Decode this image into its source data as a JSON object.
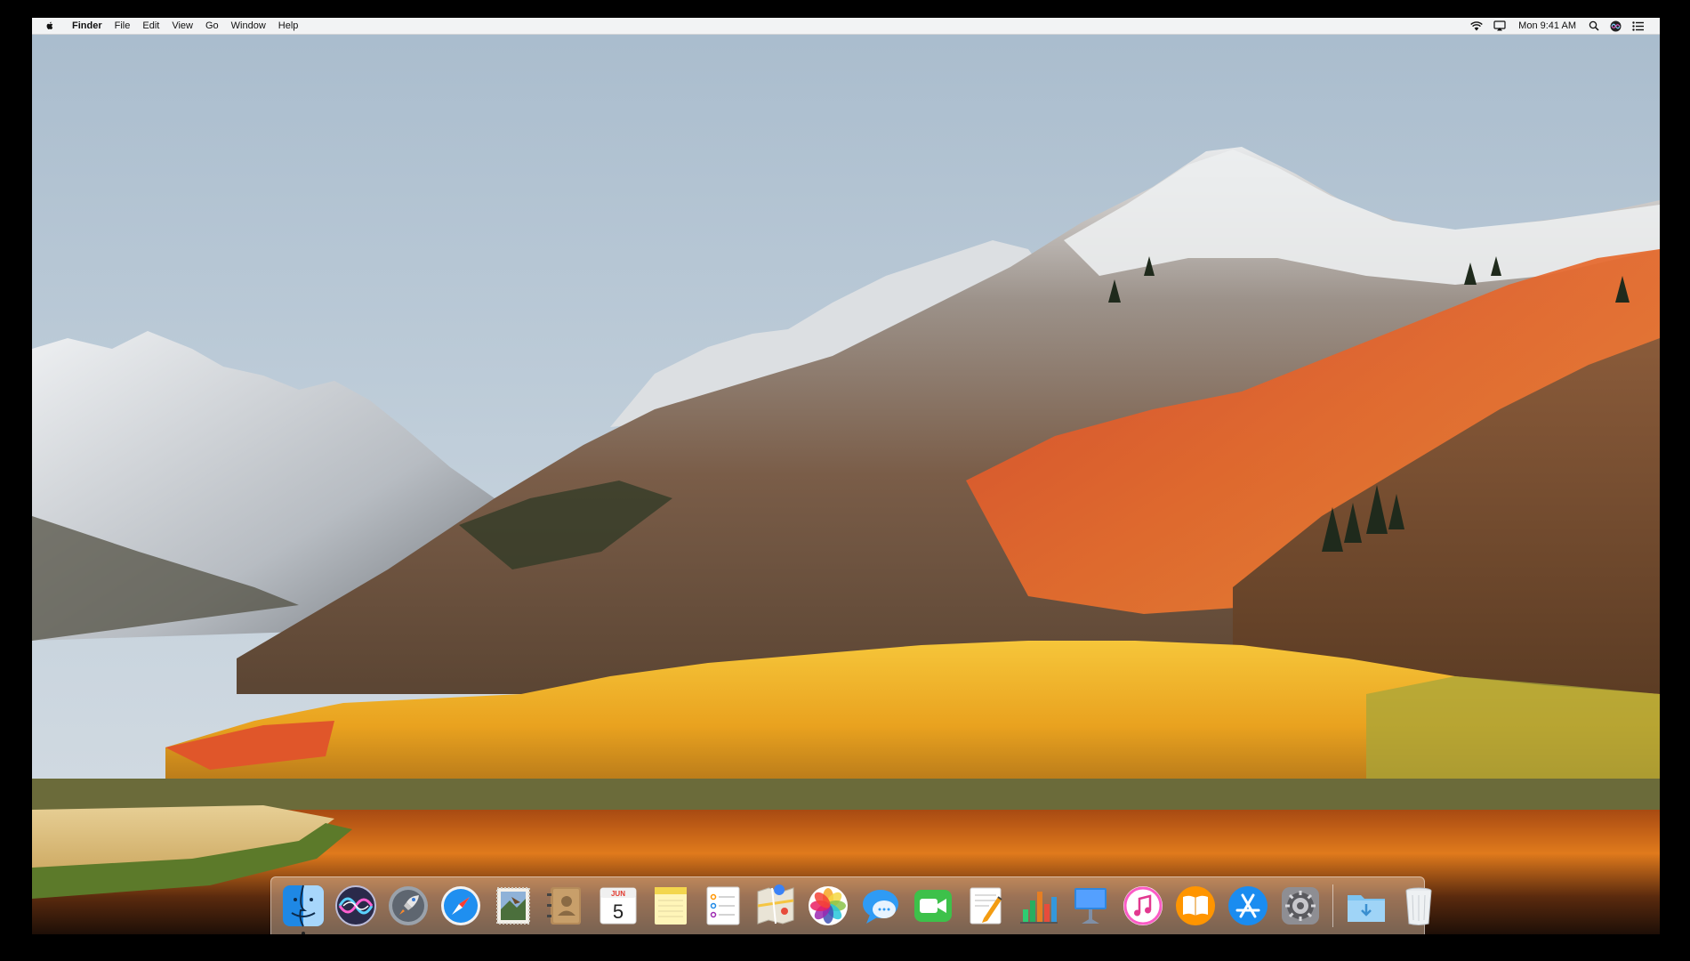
{
  "menubar": {
    "app_name": "Finder",
    "menus": [
      "File",
      "Edit",
      "View",
      "Go",
      "Window",
      "Help"
    ],
    "clock": "Mon 9:41 AM",
    "status_icons": [
      "wifi-icon",
      "airplay-icon",
      "spotlight-icon",
      "siri-icon",
      "notification-center-icon"
    ]
  },
  "dock": {
    "apps": [
      "Finder",
      "Siri",
      "Launchpad",
      "Safari",
      "Mail",
      "Contacts",
      "Calendar",
      "Notes",
      "Reminders",
      "Maps",
      "Photos",
      "Messages",
      "FaceTime",
      "Pages",
      "Numbers",
      "Keynote",
      "iTunes",
      "iBooks",
      "App Store",
      "System Preferences"
    ],
    "running": [
      "Finder"
    ],
    "stacks": [
      "Downloads",
      "Trash"
    ],
    "calendar": {
      "month": "JUN",
      "day": "5"
    }
  },
  "colors": {
    "sky": "#b9cad8",
    "snow": "#e4e7ea",
    "autumn_orange": "#e35a23",
    "aspen_yellow": "#f0b52a",
    "lake": "#2a1408"
  }
}
